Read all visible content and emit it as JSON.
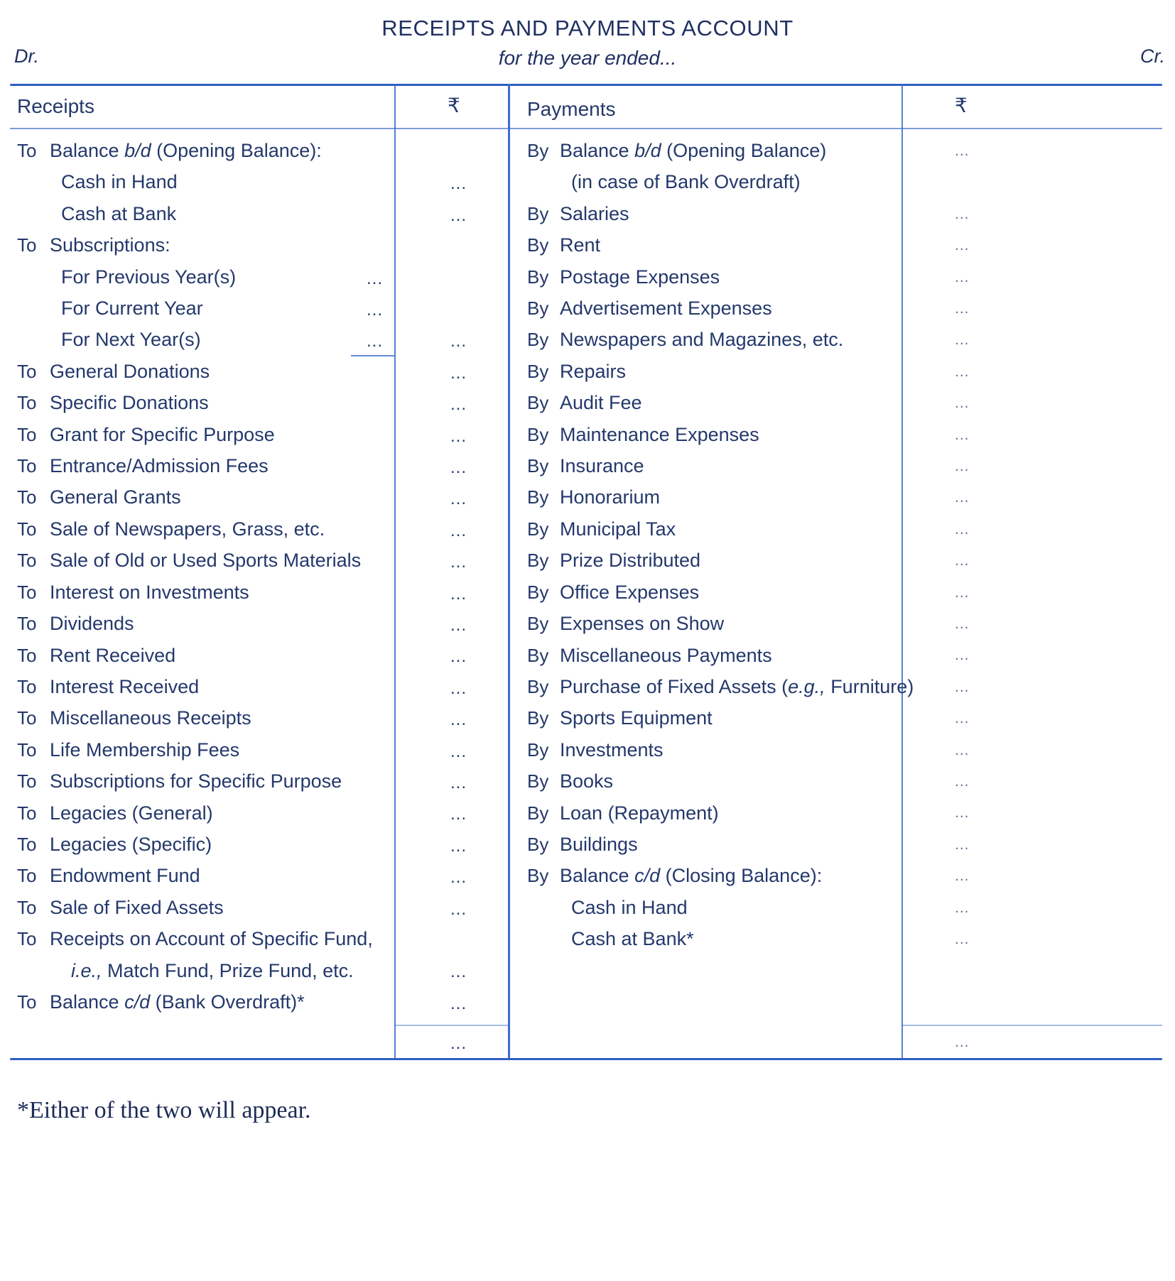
{
  "header": {
    "title": "RECEIPTS AND PAYMENTS ACCOUNT",
    "subtitle": "for the year ended...",
    "debit_marker": "Dr.",
    "credit_marker": "Cr."
  },
  "columns": {
    "receipts_header": "Receipts",
    "receipts_amount_header": "₹",
    "payments_header": "Payments",
    "payments_amount_header": "₹"
  },
  "amount_placeholder": "...",
  "receipts": [
    {
      "prefix": "To",
      "label": "Balance b/d (Opening Balance):",
      "italic": "b/d",
      "kind": "head"
    },
    {
      "prefix": "",
      "label": "Cash in Hand",
      "kind": "sub",
      "amount": "..."
    },
    {
      "prefix": "",
      "label": "Cash at Bank",
      "kind": "sub",
      "amount": "..."
    },
    {
      "prefix": "To",
      "label": "Subscriptions:",
      "kind": "head"
    },
    {
      "prefix": "",
      "label": "For Previous Year(s)",
      "kind": "sub",
      "inner": "..."
    },
    {
      "prefix": "",
      "label": "For Current Year",
      "kind": "sub",
      "inner": "..."
    },
    {
      "prefix": "",
      "label": "For Next Year(s)",
      "kind": "sub",
      "inner": "...",
      "amount": "..."
    },
    {
      "prefix": "To",
      "label": "General Donations",
      "amount": "..."
    },
    {
      "prefix": "To",
      "label": "Specific Donations",
      "amount": "..."
    },
    {
      "prefix": "To",
      "label": "Grant for Specific Purpose",
      "amount": "..."
    },
    {
      "prefix": "To",
      "label": "Entrance/Admission Fees",
      "amount": "..."
    },
    {
      "prefix": "To",
      "label": "General Grants",
      "amount": "..."
    },
    {
      "prefix": "To",
      "label": "Sale of Newspapers, Grass, etc.",
      "amount": "..."
    },
    {
      "prefix": "To",
      "label": "Sale of Old or Used Sports Materials",
      "amount": "..."
    },
    {
      "prefix": "To",
      "label": "Interest on Investments",
      "amount": "..."
    },
    {
      "prefix": "To",
      "label": "Dividends",
      "amount": "..."
    },
    {
      "prefix": "To",
      "label": "Rent Received",
      "amount": "..."
    },
    {
      "prefix": "To",
      "label": "Interest Received",
      "amount": "..."
    },
    {
      "prefix": "To",
      "label": "Miscellaneous Receipts",
      "amount": "..."
    },
    {
      "prefix": "To",
      "label": "Life Membership Fees",
      "amount": "..."
    },
    {
      "prefix": "To",
      "label": "Subscriptions for Specific Purpose",
      "amount": "..."
    },
    {
      "prefix": "To",
      "label": "Legacies (General)",
      "amount": "..."
    },
    {
      "prefix": "To",
      "label": "Legacies (Specific)",
      "amount": "..."
    },
    {
      "prefix": "To",
      "label": "Endowment Fund",
      "amount": "..."
    },
    {
      "prefix": "To",
      "label": "Sale of Fixed Assets",
      "amount": "..."
    },
    {
      "prefix": "To",
      "label": "Receipts on Account of Specific Fund,",
      "kind": "head"
    },
    {
      "prefix": "",
      "label": "i.e., Match Fund, Prize Fund, etc.",
      "italic": "i.e.,",
      "kind": "cont",
      "amount": "..."
    },
    {
      "prefix": "To",
      "label": "Balance c/d (Bank Overdraft)*",
      "italic": "c/d",
      "amount": "..."
    }
  ],
  "payments": [
    {
      "prefix": "By",
      "label": "Balance b/d (Opening Balance)",
      "italic": "b/d",
      "kind": "head",
      "amount": "..."
    },
    {
      "prefix": "",
      "label": "(in case of Bank Overdraft)",
      "kind": "sub"
    },
    {
      "prefix": "By",
      "label": "Salaries",
      "amount": "..."
    },
    {
      "prefix": "By",
      "label": "Rent",
      "amount": "..."
    },
    {
      "prefix": "By",
      "label": "Postage Expenses",
      "amount": "..."
    },
    {
      "prefix": "By",
      "label": "Advertisement Expenses",
      "amount": "..."
    },
    {
      "prefix": "By",
      "label": "Newspapers and Magazines, etc.",
      "amount": "..."
    },
    {
      "prefix": "By",
      "label": "Repairs",
      "amount": "..."
    },
    {
      "prefix": "By",
      "label": "Audit Fee",
      "amount": "..."
    },
    {
      "prefix": "By",
      "label": "Maintenance Expenses",
      "amount": "..."
    },
    {
      "prefix": "By",
      "label": "Insurance",
      "amount": "..."
    },
    {
      "prefix": "By",
      "label": "Honorarium",
      "amount": "..."
    },
    {
      "prefix": "By",
      "label": "Municipal Tax",
      "amount": "..."
    },
    {
      "prefix": "By",
      "label": "Prize Distributed",
      "amount": "..."
    },
    {
      "prefix": "By",
      "label": "Office Expenses",
      "amount": "..."
    },
    {
      "prefix": "By",
      "label": "Expenses on Show",
      "amount": "..."
    },
    {
      "prefix": "By",
      "label": "Miscellaneous Payments",
      "amount": "..."
    },
    {
      "prefix": "By",
      "label": "Purchase of Fixed Assets (e.g., Furniture)",
      "italic": "e.g.,",
      "amount": "..."
    },
    {
      "prefix": "By",
      "label": "Sports Equipment",
      "amount": "..."
    },
    {
      "prefix": "By",
      "label": "Investments",
      "amount": "..."
    },
    {
      "prefix": "By",
      "label": "Books",
      "amount": "..."
    },
    {
      "prefix": "By",
      "label": "Loan (Repayment)",
      "amount": "..."
    },
    {
      "prefix": "By",
      "label": "Buildings",
      "amount": "..."
    },
    {
      "prefix": "By",
      "label": "Balance c/d (Closing Balance):",
      "italic": "c/d",
      "kind": "head",
      "amount": "..."
    },
    {
      "prefix": "",
      "label": "Cash in Hand",
      "kind": "sub",
      "amount": "..."
    },
    {
      "prefix": "",
      "label": "Cash at Bank*",
      "kind": "sub",
      "amount": "..."
    }
  ],
  "footnote": "*Either of the two will appear."
}
